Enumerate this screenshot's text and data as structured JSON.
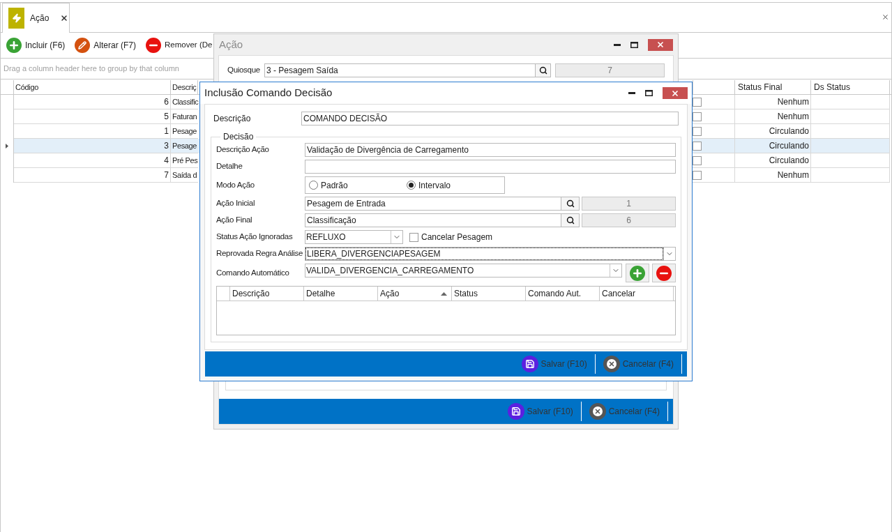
{
  "tab": {
    "label": "Ação",
    "selected": true
  },
  "toolbar": [
    {
      "kind": "add",
      "label": "Incluir (F6)"
    },
    {
      "kind": "edit",
      "label": "Alterar (F7)"
    },
    {
      "kind": "remove",
      "label": "Remover (De"
    }
  ],
  "group_panel": {
    "placeholder": "Drag a column header here to group by that column"
  },
  "grid": {
    "columns": [
      "Código",
      "Descriç",
      "Status Final",
      "Ds Status"
    ],
    "rows": [
      {
        "code": "6",
        "description": "Classific",
        "checked": false,
        "status_final": "Nenhum",
        "selected": false
      },
      {
        "code": "5",
        "description": "Faturan",
        "checked": false,
        "status_final": "Nenhum",
        "selected": false
      },
      {
        "code": "1",
        "description": "Pesage",
        "checked": false,
        "status_final": "Circulando",
        "selected": false
      },
      {
        "code": "3",
        "description": "Pesage",
        "checked": false,
        "status_final": "Circulando",
        "selected": true
      },
      {
        "code": "4",
        "description": "Pré Pes",
        "checked": false,
        "status_final": "Circulando",
        "selected": false
      },
      {
        "code": "7",
        "description": "Saída d",
        "checked": false,
        "status_final": "Nenhum",
        "selected": false
      }
    ]
  },
  "acao_dialog": {
    "title": "Ação",
    "quiosque": {
      "label": "Quiosque",
      "value": "3 - Pesagem Saída",
      "code": "7"
    },
    "buttons": [
      {
        "kind": "save",
        "label": "Salvar (F10)"
      },
      {
        "kind": "cancel",
        "label": "Cancelar (F4)"
      }
    ]
  },
  "inclusao_dialog": {
    "title": "Inclusão Comando Decisão",
    "descricao": {
      "label": "Descrição",
      "value": "COMANDO DECISÃO"
    },
    "group_title": "Decisão",
    "fields": [
      {
        "kind": "text",
        "label": "Descrição Ação",
        "value": "Validação de Divergência de Carregamento"
      },
      {
        "kind": "text",
        "label": "Detalhe"
      },
      {
        "kind": "radio",
        "label": "Modo Ação",
        "options": [
          {
            "label": "Padrão",
            "selected": false
          },
          {
            "label": "Intervalo",
            "selected": true
          }
        ]
      },
      {
        "kind": "lookup",
        "label": "Ação Inicial",
        "value": "Pesagem de Entrada",
        "code": "1"
      },
      {
        "kind": "lookup",
        "label": "Ação Final",
        "value": "Classificação",
        "code": "6"
      },
      {
        "kind": "combo_check",
        "label": "Status Ação Ignoradas",
        "value": "REFLUXO",
        "check_label": "Cancelar Pesagem",
        "checked": false
      },
      {
        "kind": "combo",
        "label": "Reprovada Regra Análise",
        "value": "LIBERA_DIVERGENCIAPESAGEM",
        "focused": true
      },
      {
        "kind": "combo_buttons",
        "label": "Comando Automático",
        "value": "VALIDA_DIVERGENCIA_CARREGAMENTO"
      }
    ],
    "table": {
      "columns": [
        {
          "label": "Descrição",
          "sorted": false
        },
        {
          "label": "Detalhe",
          "sorted": false
        },
        {
          "label": "Ação",
          "sorted": true
        },
        {
          "label": "Status",
          "sorted": false
        },
        {
          "label": "Comando Aut.",
          "sorted": false
        },
        {
          "label": "Cancelar",
          "sorted": false
        }
      ]
    },
    "buttons": [
      {
        "kind": "save",
        "label": "Salvar (F10)"
      },
      {
        "kind": "cancel",
        "label": "Cancelar (F4)"
      }
    ]
  }
}
